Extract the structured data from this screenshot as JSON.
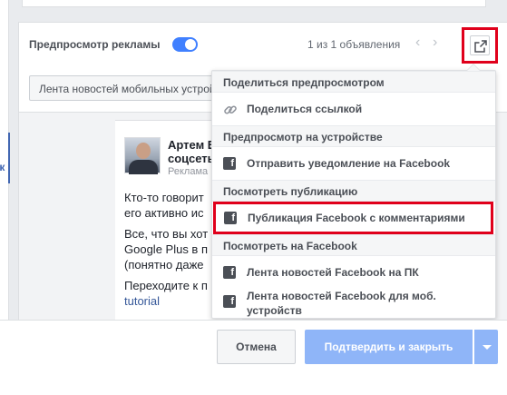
{
  "preview": {
    "label": "Предпросмотр рекламы",
    "toggle_on": true,
    "ad_count": "1 из 1 объявления",
    "prev_arrow": "‹",
    "next_arrow": "›"
  },
  "placement": {
    "value": "Лента новостей мобильных устройств"
  },
  "ad_post": {
    "author_line1": "Артем Б",
    "author_line2": "соцсеть",
    "sponsored": "Реклама",
    "text_p1_l1": "Кто-то говорит",
    "text_p1_l2": "его активно ис",
    "text_p2_l1": "Все, что вы хот",
    "text_p2_l2": "Google Plus в п",
    "text_p2_l3": "(понятно даже",
    "text_p3_l1": "Переходите к п",
    "text_p3_link": "tutorial"
  },
  "left_card": {
    "label": "ик"
  },
  "share_menu": {
    "sections": [
      {
        "header": "Поделиться предпросмотром",
        "items": [
          {
            "label": "Поделиться ссылкой",
            "icon": "link-icon"
          }
        ]
      },
      {
        "header": "Предпросмотр на устройстве",
        "items": [
          {
            "label": "Отправить уведомление на Facebook",
            "icon": "facebook-icon"
          }
        ]
      },
      {
        "header": "Посмотреть публикацию",
        "items": [
          {
            "label": "Публикация Facebook с комментариями",
            "icon": "facebook-icon",
            "highlighted": true
          }
        ]
      },
      {
        "header": "Посмотреть на Facebook",
        "items": [
          {
            "label": "Лента новостей Facebook на ПК",
            "icon": "facebook-icon"
          },
          {
            "label": "Лента новостей Facebook для моб. устройств",
            "icon": "facebook-icon"
          }
        ]
      }
    ],
    "fb_glyph": "f"
  },
  "footer": {
    "cancel_label": "Отмена",
    "confirm_label": "Подтвердить и закрыть"
  },
  "colors": {
    "accent": "#4080ff",
    "highlight_border": "#e0001b",
    "confirm_disabled": "#8fb5f8"
  }
}
